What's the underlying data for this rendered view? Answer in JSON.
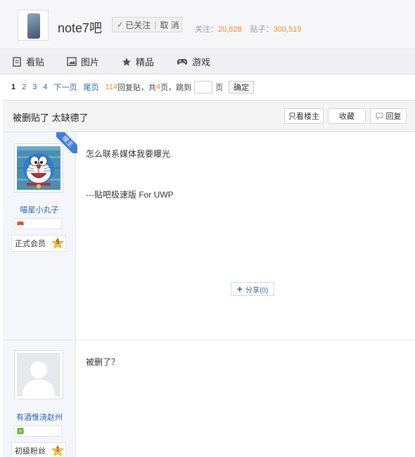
{
  "header": {
    "forum_name": "note7吧",
    "follow_check": "✓",
    "follow_label": "已关注",
    "follow_sep": "|",
    "unfollow_label": "取 消",
    "followers_label": "关注：",
    "followers_count": "20,828",
    "posts_label": "贴子：",
    "posts_count": "300,519"
  },
  "nav": {
    "items": [
      {
        "label": "看贴",
        "icon": "doc-icon"
      },
      {
        "label": "图片",
        "icon": "image-icon"
      },
      {
        "label": "精品",
        "icon": "star-icon"
      },
      {
        "label": "游戏",
        "icon": "gamepad-icon"
      }
    ]
  },
  "pager": {
    "current": "1",
    "pages": [
      "2",
      "3",
      "4"
    ],
    "next": "下一页",
    "last": "尾页",
    "reply_count": "114",
    "reply_suffix": "回复贴，共",
    "total_pages": "4",
    "pages_suffix": "页，跳到",
    "page_unit": "页",
    "confirm": "确定"
  },
  "thread": {
    "title": "被删贴了 太缺德了",
    "only_op": "只看楼主",
    "favorite": "收藏",
    "reply": "回复"
  },
  "posts": [
    {
      "author": "喵星小丸子",
      "op_tag": "楼主",
      "member_label": "正式会员",
      "level": "5",
      "line1": "怎么联系媒体我要曝光",
      "line2": "---贴吧极速版 For UWP",
      "share": "分享(0)"
    },
    {
      "author": "有酒惟浇赵州",
      "member_label": "初级粉丝",
      "level": "1",
      "line1": "被删了？"
    }
  ]
}
